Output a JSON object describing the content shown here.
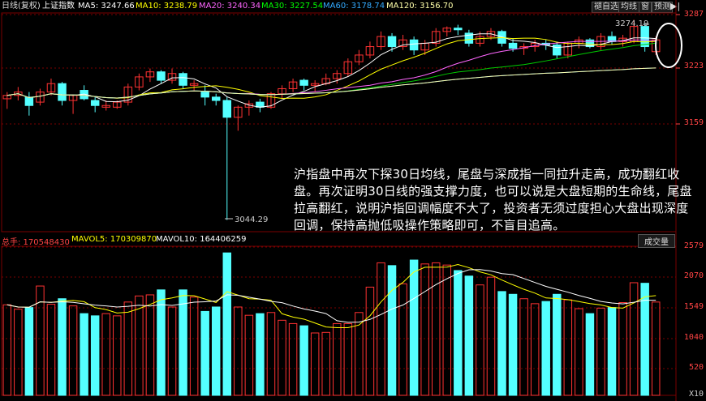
{
  "header": {
    "period": "日线(复权)",
    "index_name": "上证指数",
    "ma": [
      {
        "label": "MA5: 3247.66",
        "color": "#ffffff"
      },
      {
        "label": "MA10: 3238.79",
        "color": "#ffff00"
      },
      {
        "label": "MA20: 3240.34",
        "color": "#ff66ff"
      },
      {
        "label": "MA30: 3227.54",
        "color": "#00ff00"
      },
      {
        "label": "MA60: 3178.74",
        "color": "#33aaff"
      },
      {
        "label": "MA120: 3156.70",
        "color": "#ffffaa"
      }
    ],
    "buttons": [
      "褪自选",
      "均线",
      "窗",
      "预测"
    ]
  },
  "price_axis": {
    "labels": [
      "3287",
      "3223",
      "3159"
    ]
  },
  "price_marks": {
    "high": "3274.19",
    "low": "3044.29"
  },
  "annotation": "沪指盘中再次下探30日均线，尾盘与深成指一同拉升走高，成功翻红收盘。再次证明30日线的强支撑力度，也可以说是大盘短期的生命线，尾盘拉高翻红，说明沪指回调幅度不大了，投资者无须过度担心大盘出现深度回调，保持高抛低吸操作策略即可，不盲目追高。",
  "volume_header": {
    "total": "总手: 170548430",
    "mavol5": "MAVOL5: 170309870",
    "mavol10": "MAVOL10: 164406259",
    "dropdown": "成交量"
  },
  "volume_axis": {
    "labels": [
      "2579",
      "2070",
      "1549",
      "1040",
      "520"
    ],
    "unit": "X10"
  },
  "colors": {
    "up": "#ff3232",
    "down": "#54ffff",
    "bg": "#000000",
    "grid": "#7a0000"
  },
  "chart_data": {
    "type": "candlestick",
    "note_series": [
      "open",
      "high",
      "low",
      "close",
      "volume"
    ],
    "candles": [
      {
        "o": 3188,
        "h": 3196,
        "l": 3176,
        "c": 3192,
        "v": 1640,
        "up": true
      },
      {
        "o": 3192,
        "h": 3202,
        "l": 3186,
        "c": 3196,
        "v": 1560,
        "up": true
      },
      {
        "o": 3190,
        "h": 3196,
        "l": 3168,
        "c": 3180,
        "v": 1590,
        "up": false
      },
      {
        "o": 3184,
        "h": 3200,
        "l": 3180,
        "c": 3196,
        "v": 1980,
        "up": true
      },
      {
        "o": 3196,
        "h": 3212,
        "l": 3192,
        "c": 3206,
        "v": 1650,
        "up": true
      },
      {
        "o": 3206,
        "h": 3208,
        "l": 3180,
        "c": 3186,
        "v": 1750,
        "up": false
      },
      {
        "o": 3186,
        "h": 3192,
        "l": 3170,
        "c": 3192,
        "v": 1620,
        "up": true
      },
      {
        "o": 3198,
        "h": 3204,
        "l": 3186,
        "c": 3188,
        "v": 1480,
        "up": false
      },
      {
        "o": 3186,
        "h": 3190,
        "l": 3172,
        "c": 3180,
        "v": 1440,
        "up": false
      },
      {
        "o": 3180,
        "h": 3186,
        "l": 3174,
        "c": 3178,
        "v": 1480,
        "up": true
      },
      {
        "o": 3178,
        "h": 3186,
        "l": 3176,
        "c": 3184,
        "v": 1440,
        "up": true
      },
      {
        "o": 3184,
        "h": 3206,
        "l": 3180,
        "c": 3202,
        "v": 1690,
        "up": true
      },
      {
        "o": 3202,
        "h": 3218,
        "l": 3198,
        "c": 3214,
        "v": 1800,
        "up": true
      },
      {
        "o": 3214,
        "h": 3224,
        "l": 3208,
        "c": 3220,
        "v": 1820,
        "up": true
      },
      {
        "o": 3220,
        "h": 3222,
        "l": 3206,
        "c": 3210,
        "v": 1910,
        "up": false
      },
      {
        "o": 3210,
        "h": 3224,
        "l": 3206,
        "c": 3218,
        "v": 1600,
        "up": true
      },
      {
        "o": 3218,
        "h": 3220,
        "l": 3200,
        "c": 3204,
        "v": 1910,
        "up": false
      },
      {
        "o": 3204,
        "h": 3210,
        "l": 3198,
        "c": 3206,
        "v": 1780,
        "up": true
      },
      {
        "o": 3196,
        "h": 3204,
        "l": 3180,
        "c": 3190,
        "v": 1520,
        "up": false
      },
      {
        "o": 3190,
        "h": 3194,
        "l": 3180,
        "c": 3186,
        "v": 1600,
        "up": false
      },
      {
        "o": 3186,
        "h": 3190,
        "l": 3044,
        "c": 3166,
        "v": 2580,
        "up": false
      },
      {
        "o": 3166,
        "h": 3180,
        "l": 3150,
        "c": 3178,
        "v": 1600,
        "up": true
      },
      {
        "o": 3178,
        "h": 3186,
        "l": 3168,
        "c": 3182,
        "v": 1450,
        "up": true
      },
      {
        "o": 3184,
        "h": 3188,
        "l": 3172,
        "c": 3178,
        "v": 1480,
        "up": false
      },
      {
        "o": 3178,
        "h": 3196,
        "l": 3176,
        "c": 3194,
        "v": 1500,
        "up": true
      },
      {
        "o": 3194,
        "h": 3204,
        "l": 3188,
        "c": 3200,
        "v": 1360,
        "up": true
      },
      {
        "o": 3200,
        "h": 3212,
        "l": 3196,
        "c": 3208,
        "v": 1300,
        "up": true
      },
      {
        "o": 3210,
        "h": 3212,
        "l": 3198,
        "c": 3204,
        "v": 1260,
        "up": false
      },
      {
        "o": 3204,
        "h": 3210,
        "l": 3196,
        "c": 3206,
        "v": 1130,
        "up": true
      },
      {
        "o": 3206,
        "h": 3218,
        "l": 3204,
        "c": 3212,
        "v": 1140,
        "up": true
      },
      {
        "o": 3212,
        "h": 3222,
        "l": 3206,
        "c": 3218,
        "v": 1300,
        "up": true
      },
      {
        "o": 3218,
        "h": 3236,
        "l": 3214,
        "c": 3232,
        "v": 1300,
        "up": true
      },
      {
        "o": 3232,
        "h": 3246,
        "l": 3228,
        "c": 3240,
        "v": 1500,
        "up": true
      },
      {
        "o": 3240,
        "h": 3256,
        "l": 3236,
        "c": 3250,
        "v": 1960,
        "up": true
      },
      {
        "o": 3250,
        "h": 3268,
        "l": 3246,
        "c": 3262,
        "v": 2400,
        "up": true
      },
      {
        "o": 3262,
        "h": 3266,
        "l": 3244,
        "c": 3250,
        "v": 2350,
        "up": false
      },
      {
        "o": 3250,
        "h": 3264,
        "l": 3246,
        "c": 3258,
        "v": 2020,
        "up": true
      },
      {
        "o": 3258,
        "h": 3262,
        "l": 3240,
        "c": 3246,
        "v": 2450,
        "up": false
      },
      {
        "o": 3246,
        "h": 3258,
        "l": 3240,
        "c": 3254,
        "v": 2380,
        "up": true
      },
      {
        "o": 3254,
        "h": 3272,
        "l": 3250,
        "c": 3268,
        "v": 2400,
        "up": true
      },
      {
        "o": 3268,
        "h": 3274,
        "l": 3262,
        "c": 3272,
        "v": 2360,
        "up": true
      },
      {
        "o": 3272,
        "h": 3276,
        "l": 3264,
        "c": 3270,
        "v": 2260,
        "up": false
      },
      {
        "o": 3266,
        "h": 3270,
        "l": 3250,
        "c": 3254,
        "v": 2160,
        "up": false
      },
      {
        "o": 3254,
        "h": 3268,
        "l": 3250,
        "c": 3262,
        "v": 2000,
        "up": true
      },
      {
        "o": 3262,
        "h": 3272,
        "l": 3258,
        "c": 3268,
        "v": 2140,
        "up": true
      },
      {
        "o": 3268,
        "h": 3270,
        "l": 3250,
        "c": 3254,
        "v": 1880,
        "up": false
      },
      {
        "o": 3254,
        "h": 3260,
        "l": 3244,
        "c": 3248,
        "v": 1830,
        "up": false
      },
      {
        "o": 3248,
        "h": 3254,
        "l": 3240,
        "c": 3250,
        "v": 1750,
        "up": true
      },
      {
        "o": 3250,
        "h": 3258,
        "l": 3244,
        "c": 3254,
        "v": 1660,
        "up": true
      },
      {
        "o": 3254,
        "h": 3258,
        "l": 3246,
        "c": 3252,
        "v": 1700,
        "up": false
      },
      {
        "o": 3252,
        "h": 3256,
        "l": 3236,
        "c": 3240,
        "v": 1830,
        "up": false
      },
      {
        "o": 3240,
        "h": 3256,
        "l": 3236,
        "c": 3254,
        "v": 1730,
        "up": true
      },
      {
        "o": 3254,
        "h": 3262,
        "l": 3248,
        "c": 3258,
        "v": 1570,
        "up": true
      },
      {
        "o": 3258,
        "h": 3260,
        "l": 3248,
        "c": 3250,
        "v": 1480,
        "up": false
      },
      {
        "o": 3250,
        "h": 3266,
        "l": 3246,
        "c": 3262,
        "v": 1580,
        "up": true
      },
      {
        "o": 3262,
        "h": 3268,
        "l": 3252,
        "c": 3256,
        "v": 1590,
        "up": false
      },
      {
        "o": 3256,
        "h": 3264,
        "l": 3250,
        "c": 3260,
        "v": 1680,
        "up": true
      },
      {
        "o": 3256,
        "h": 3282,
        "l": 3254,
        "c": 3274,
        "v": 2040,
        "up": true
      },
      {
        "o": 3274,
        "h": 3278,
        "l": 3244,
        "c": 3250,
        "v": 2030,
        "up": false
      },
      {
        "o": 3244,
        "h": 3262,
        "l": 3240,
        "c": 3258,
        "v": 1690,
        "up": true
      }
    ],
    "ylim_price": [
      3030,
      3290
    ],
    "ylim_volume": [
      0,
      2700
    ]
  }
}
